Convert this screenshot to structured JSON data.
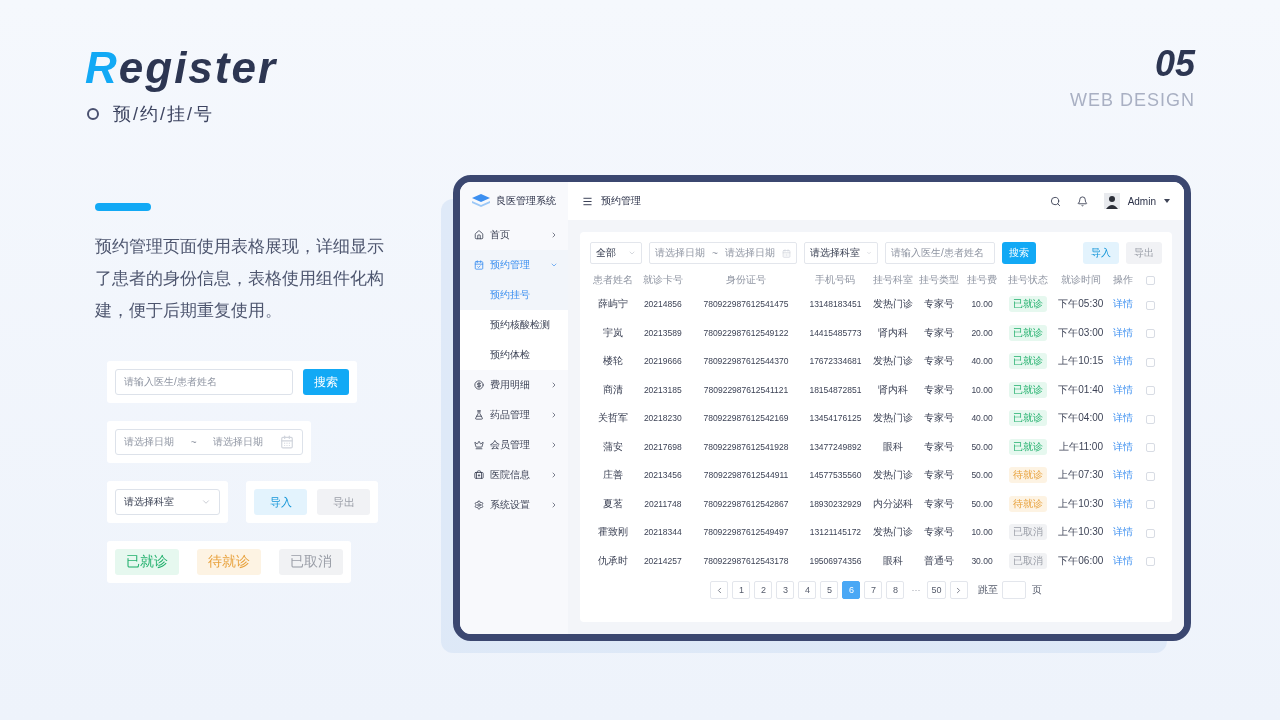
{
  "header": {
    "title_initial": "R",
    "title_rest": "egister",
    "subtitle": "预/约/挂/号",
    "number": "05",
    "caption": "WEB DESIGN"
  },
  "description": "预约管理页面使用表格展现，详细显示了患者的身份信息，表格使用组件化构建，便于后期重复使用。",
  "showcase": {
    "search_placeholder": "请输入医生/患者姓名",
    "search_button": "搜索",
    "date_start": "请选择日期",
    "date_separator": "~",
    "date_end": "请选择日期",
    "dept_placeholder": "请选择科室",
    "buttons": [
      {
        "label": "导入",
        "disabled": false
      },
      {
        "label": "导出",
        "disabled": true
      }
    ],
    "tags": [
      {
        "label": "已就诊",
        "kind": "done"
      },
      {
        "label": "待就诊",
        "kind": "waiting"
      },
      {
        "label": "已取消",
        "kind": "cancelled"
      }
    ]
  },
  "app": {
    "brand": "良医管理系统",
    "nav": [
      {
        "label": "首页",
        "selected": false,
        "expanded": false
      },
      {
        "label": "预约管理",
        "selected": true,
        "expanded": true,
        "children": [
          {
            "label": "预约挂号",
            "selected": true
          },
          {
            "label": "预约核酸检测",
            "selected": false
          },
          {
            "label": "预约体检",
            "selected": false
          }
        ]
      },
      {
        "label": "费用明细",
        "selected": false,
        "expanded": false
      },
      {
        "label": "药品管理",
        "selected": false,
        "expanded": false
      },
      {
        "label": "会员管理",
        "selected": false,
        "expanded": false
      },
      {
        "label": "医院信息",
        "selected": false,
        "expanded": false
      },
      {
        "label": "系统设置",
        "selected": false,
        "expanded": false
      }
    ],
    "page_title": "预约管理",
    "user": "Admin",
    "filters": {
      "type_select": "全部",
      "date_start": "请选择日期",
      "date_separator": "~",
      "date_end": "请选择日期",
      "dept_placeholder": "请选择科室",
      "search_placeholder": "请输入医生/患者姓名",
      "search_button": "搜索",
      "buttons": [
        {
          "label": "导入",
          "disabled": false
        },
        {
          "label": "导出",
          "disabled": true
        }
      ]
    },
    "table": {
      "columns": [
        "患者姓名",
        "就诊卡号",
        "身份证号",
        "手机号码",
        "挂号科室",
        "挂号类型",
        "挂号费",
        "挂号状态",
        "就诊时间",
        "操作"
      ],
      "header_checked": false,
      "rows": [
        {
          "name": "薛屿宁",
          "card": "20214856",
          "id": "780922987612541475",
          "phone": "13148183451",
          "dept": "发热门诊",
          "type": "专家号",
          "fee": "10.00",
          "status": {
            "label": "已就诊",
            "kind": "done"
          },
          "time": "下午05:30",
          "action": "详情",
          "checked": false
        },
        {
          "name": "宇岚",
          "card": "20213589",
          "id": "780922987612549122",
          "phone": "14415485773",
          "dept": "肾内科",
          "type": "专家号",
          "fee": "20.00",
          "status": {
            "label": "已就诊",
            "kind": "done"
          },
          "time": "下午03:00",
          "action": "详情",
          "checked": false
        },
        {
          "name": "楼轮",
          "card": "20219666",
          "id": "780922987612544370",
          "phone": "17672334681",
          "dept": "发热门诊",
          "type": "专家号",
          "fee": "40.00",
          "status": {
            "label": "已就诊",
            "kind": "done"
          },
          "time": "上午10:15",
          "action": "详情",
          "checked": false
        },
        {
          "name": "商清",
          "card": "20213185",
          "id": "780922987612541121",
          "phone": "18154872851",
          "dept": "肾内科",
          "type": "专家号",
          "fee": "10.00",
          "status": {
            "label": "已就诊",
            "kind": "done"
          },
          "time": "下午01:40",
          "action": "详情",
          "checked": false
        },
        {
          "name": "关哲军",
          "card": "20218230",
          "id": "780922987612542169",
          "phone": "13454176125",
          "dept": "发热门诊",
          "type": "专家号",
          "fee": "40.00",
          "status": {
            "label": "已就诊",
            "kind": "done"
          },
          "time": "下午04:00",
          "action": "详情",
          "checked": false
        },
        {
          "name": "蒲安",
          "card": "20217698",
          "id": "780922987612541928",
          "phone": "13477249892",
          "dept": "眼科",
          "type": "专家号",
          "fee": "50.00",
          "status": {
            "label": "已就诊",
            "kind": "done"
          },
          "time": "上午11:00",
          "action": "详情",
          "checked": false
        },
        {
          "name": "庄善",
          "card": "20213456",
          "id": "780922987612544911",
          "phone": "14577535560",
          "dept": "发热门诊",
          "type": "专家号",
          "fee": "50.00",
          "status": {
            "label": "待就诊",
            "kind": "waiting"
          },
          "time": "上午07:30",
          "action": "详情",
          "checked": false
        },
        {
          "name": "夏茗",
          "card": "20211748",
          "id": "780922987612542867",
          "phone": "18930232929",
          "dept": "内分泌科",
          "type": "专家号",
          "fee": "50.00",
          "status": {
            "label": "待就诊",
            "kind": "waiting"
          },
          "time": "上午10:30",
          "action": "详情",
          "checked": false
        },
        {
          "name": "霍致刚",
          "card": "20218344",
          "id": "780922987612549497",
          "phone": "13121145172",
          "dept": "发热门诊",
          "type": "专家号",
          "fee": "10.00",
          "status": {
            "label": "已取消",
            "kind": "cancelled"
          },
          "time": "上午10:30",
          "action": "详情",
          "checked": false
        },
        {
          "name": "仇承时",
          "card": "20214257",
          "id": "780922987612543178",
          "phone": "19506974356",
          "dept": "眼科",
          "type": "普通号",
          "fee": "30.00",
          "status": {
            "label": "已取消",
            "kind": "cancelled"
          },
          "time": "下午06:00",
          "action": "详情",
          "checked": false
        }
      ]
    },
    "pagination": {
      "pages": [
        {
          "label": "1",
          "selected": false,
          "kind": "page"
        },
        {
          "label": "2",
          "selected": false,
          "kind": "page"
        },
        {
          "label": "3",
          "selected": false,
          "kind": "page"
        },
        {
          "label": "4",
          "selected": false,
          "kind": "page"
        },
        {
          "label": "5",
          "selected": false,
          "kind": "page"
        },
        {
          "label": "6",
          "selected": true,
          "kind": "page"
        },
        {
          "label": "7",
          "selected": false,
          "kind": "page"
        },
        {
          "label": "8",
          "selected": false,
          "kind": "page"
        },
        {
          "label": "···",
          "kind": "ellipsis"
        },
        {
          "label": "50",
          "selected": false,
          "kind": "page"
        }
      ],
      "jump_label": "跳至",
      "jump_suffix": "页"
    }
  }
}
